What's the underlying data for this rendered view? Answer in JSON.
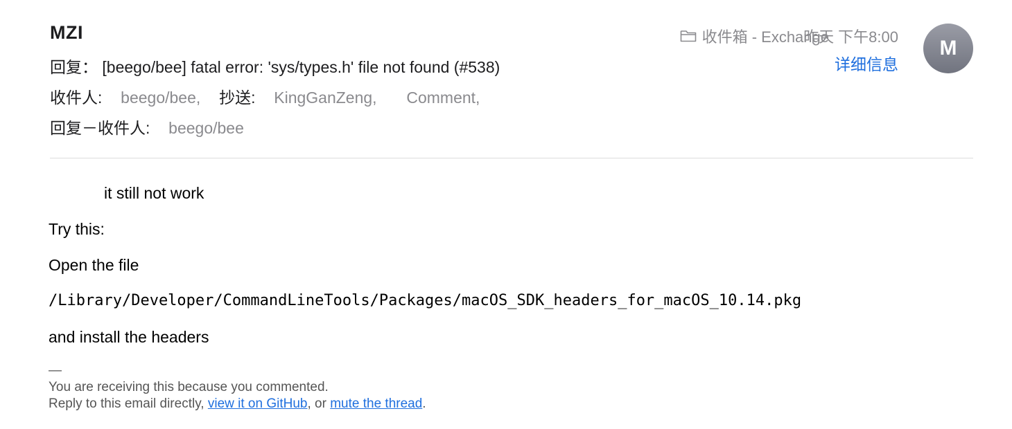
{
  "header": {
    "sender": "MZI",
    "subject": "回复： [beego/bee] fatal error: 'sys/types.h' file not found (#538)",
    "to_label": "收件人:",
    "to_value": "beego/bee,",
    "cc_label": "抄送:",
    "cc_value_1": "KingGanZeng,",
    "cc_value_2": "Comment,",
    "replyto_label": "回复－收件人:",
    "replyto_value": "beego/bee",
    "mailbox": "收件箱 - Exchange",
    "mailbox_icon": "folder-icon",
    "date": "昨天 下午8:00",
    "details_link": "详细信息",
    "avatar_initial": "M",
    "accent_color": "#1f6fde"
  },
  "body": {
    "line1": "it still not work",
    "line2": "Try this:",
    "line3": "Open the file",
    "line4": "/Library/Developer/CommandLineTools/Packages/macOS_SDK_headers_for_macOS_10.14.pkg",
    "line5": "and install the headers"
  },
  "footer": {
    "dash": "—",
    "line1": "You are receiving this because you commented.",
    "line2_prefix": "Reply to this email directly, ",
    "link_github": "view it on GitHub",
    "line2_middle": ", or ",
    "link_mute": "mute the thread",
    "line2_suffix": "."
  }
}
